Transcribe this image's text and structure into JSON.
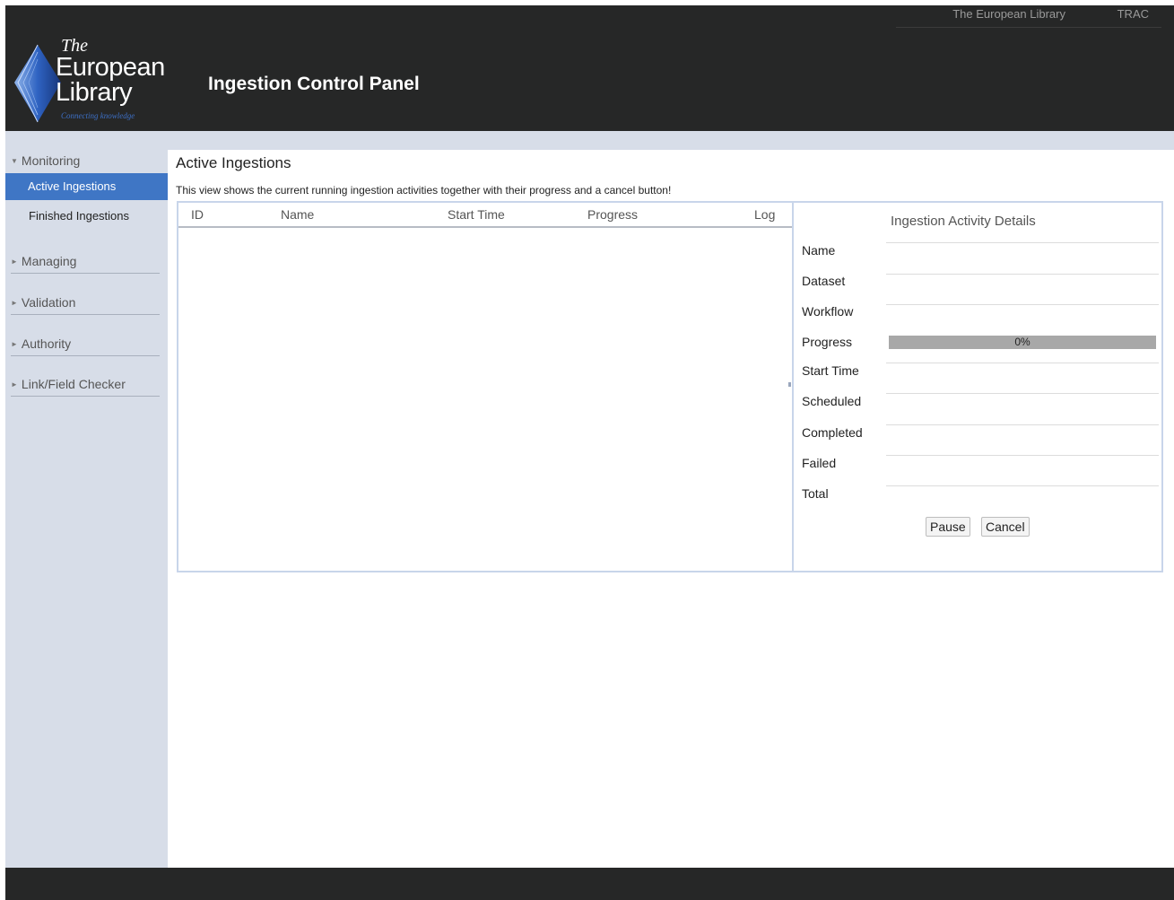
{
  "header": {
    "links": [
      "The European Library",
      "TRAC"
    ],
    "logo": {
      "the": "The",
      "line1": "European",
      "line2": "Library",
      "tagline": "Connecting knowledge"
    },
    "app_title": "Ingestion Control Panel"
  },
  "sidebar": {
    "groups": [
      {
        "label": "Monitoring",
        "expanded": true
      },
      {
        "label": "Managing",
        "expanded": false
      },
      {
        "label": "Validation",
        "expanded": false
      },
      {
        "label": "Authority",
        "expanded": false
      },
      {
        "label": "Link/Field Checker",
        "expanded": false
      }
    ],
    "monitoring_items": [
      {
        "label": "Active Ingestions",
        "active": true
      },
      {
        "label": "Finished Ingestions",
        "active": false
      }
    ]
  },
  "main": {
    "title": "Active Ingestions",
    "description": "This view shows the current running ingestion activities together with their progress and a cancel button!",
    "columns": [
      "ID",
      "Name",
      "Start Time",
      "Progress",
      "Log"
    ],
    "rows": []
  },
  "details": {
    "title": "Ingestion Activity Details",
    "fields": {
      "name": {
        "label": "Name",
        "value": ""
      },
      "dataset": {
        "label": "Dataset",
        "value": ""
      },
      "workflow": {
        "label": "Workflow",
        "value": ""
      },
      "progress": {
        "label": "Progress",
        "value": "0%",
        "fraction": 0
      },
      "start_time": {
        "label": "Start Time",
        "value": ""
      },
      "scheduled": {
        "label": "Scheduled",
        "value": ""
      },
      "completed": {
        "label": "Completed",
        "value": ""
      },
      "failed": {
        "label": "Failed",
        "value": ""
      },
      "total": {
        "label": "Total",
        "value": ""
      }
    },
    "pause_label": "Pause",
    "cancel_label": "Cancel"
  },
  "colors": {
    "header_bg": "#262727",
    "sidebar_bg": "#d7dde8",
    "active_nav": "#3f76c5",
    "panel_border": "#c8d5ea",
    "progress_fill": "#a8a8a8"
  }
}
